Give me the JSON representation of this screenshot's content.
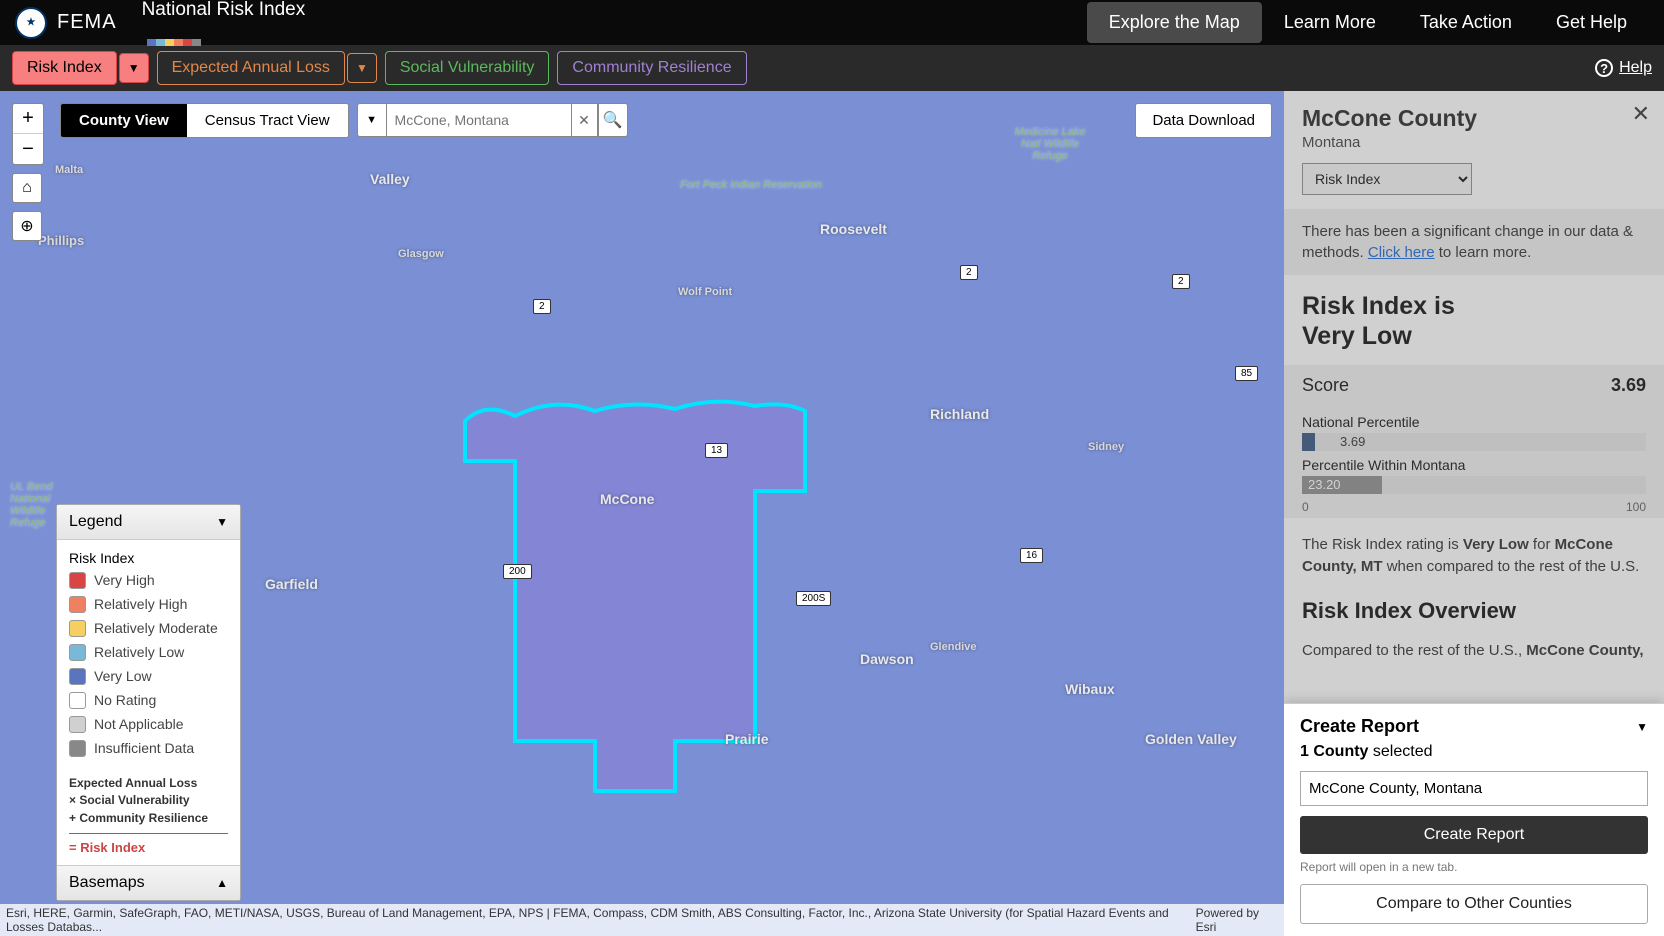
{
  "header": {
    "agency": "FEMA",
    "app_title": "National Risk Index",
    "nav": [
      "Explore the Map",
      "Learn More",
      "Take Action",
      "Get Help"
    ],
    "active_nav": 0
  },
  "filters": {
    "risk": "Risk Index",
    "eal": "Expected Annual Loss",
    "soc": "Social Vulnerability",
    "com": "Community Resilience",
    "help": "Help"
  },
  "map_controls": {
    "county_view": "County View",
    "tract_view": "Census Tract View",
    "search_placeholder": "McCone, Montana",
    "data_download": "Data Download"
  },
  "map_labels": {
    "valley": "Valley",
    "roosevelt": "Roosevelt",
    "richland": "Richland",
    "mccone": "McCone",
    "dawson": "Dawson",
    "garfield": "Garfield",
    "prairie": "Prairie",
    "wibaux": "Wibaux",
    "golden_valley": "Golden Valley",
    "phillips": "Phillips",
    "malta": "Malta",
    "glasgow": "Glasgow",
    "wolf_point": "Wolf Point",
    "sidney": "Sidney",
    "glendive": "Glendive",
    "fort_peck": "Fort Peck Indian Reservation",
    "medicine_lake": "Medicine Lake Natl Wildlife Refuge",
    "ul_bend": "UL Bend National Wildlife Refuge"
  },
  "routes": {
    "r2a": "2",
    "r2b": "2",
    "r2c": "2",
    "r85": "85",
    "r13": "13",
    "r200": "200",
    "r200s": "200S",
    "r16": "16"
  },
  "legend": {
    "title": "Legend",
    "section": "Risk Index",
    "items": [
      {
        "label": "Very High",
        "color": "#d84545"
      },
      {
        "label": "Relatively High",
        "color": "#f08060"
      },
      {
        "label": "Relatively Moderate",
        "color": "#f5d060"
      },
      {
        "label": "Relatively Low",
        "color": "#7ab8d8"
      },
      {
        "label": "Very Low",
        "color": "#5a75c0"
      },
      {
        "label": "No Rating",
        "color": "#ffffff"
      },
      {
        "label": "Not Applicable",
        "color": "#d0d0d0"
      },
      {
        "label": "Insufficient Data",
        "color": "#888888"
      }
    ],
    "formula1": "Expected Annual Loss",
    "formula2": "× Social Vulnerability",
    "formula3": "+ Community Resilience",
    "result": "= Risk Index",
    "basemaps": "Basemaps"
  },
  "attribution": {
    "left": "Esri, HERE, Garmin, SafeGraph, FAO, METI/NASA, USGS, Bureau of Land Management, EPA, NPS | FEMA, Compass, CDM Smith, ABS Consulting, Factor, Inc., Arizona State University (for Spatial Hazard Events and Losses Databas...",
    "right": "Powered by Esri"
  },
  "panel": {
    "title": "McCone County",
    "state": "Montana",
    "dropdown": "Risk Index",
    "notice_a": "There has been a significant change in our data & methods. ",
    "notice_link": "Click here",
    "notice_b": " to learn more.",
    "rating_label": "Risk Index is",
    "rating_value": "Very Low",
    "score_label": "Score",
    "score_value": "3.69",
    "nat_perc_label": "National Percentile",
    "nat_perc_value": "3.69",
    "state_perc_label": "Percentile Within Montana",
    "state_perc_value": "23.20",
    "axis_min": "0",
    "axis_max": "100",
    "desc_a": "The Risk Index rating is ",
    "desc_b": "Very Low",
    "desc_c": " for ",
    "desc_d": "McCone County, MT",
    "desc_e": " when compared to the rest of the U.S.",
    "overview": "Risk Index Overview",
    "overview_a": "Compared to the rest of the U.S., ",
    "overview_b": "McCone County,"
  },
  "report": {
    "title": "Create Report",
    "count": "1 County",
    "selected": " selected",
    "input_value": "McCone County, Montana",
    "create": "Create Report",
    "note": "Report will open in a new tab.",
    "compare": "Compare to Other Counties"
  }
}
